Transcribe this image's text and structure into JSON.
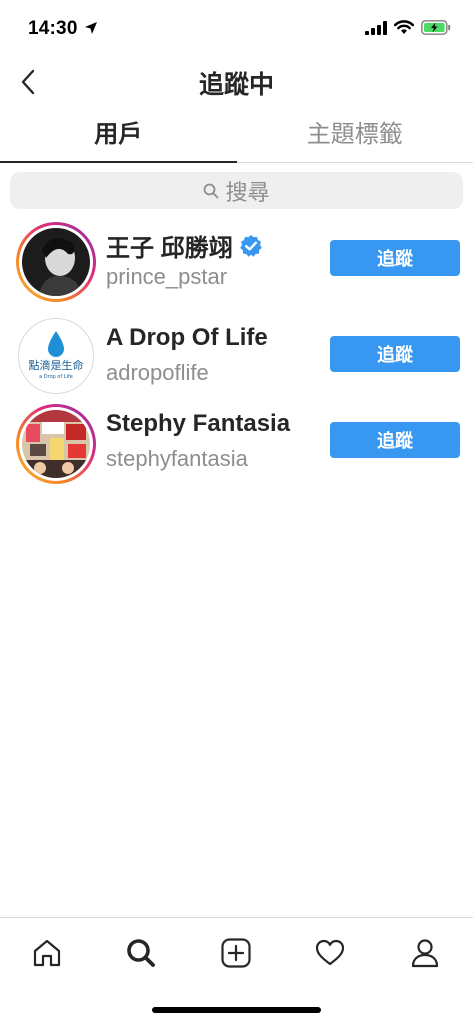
{
  "status_bar": {
    "time": "14:30"
  },
  "header": {
    "title": "追蹤中"
  },
  "tabs": [
    {
      "label": "用戶"
    },
    {
      "label": "主題標籤"
    }
  ],
  "search": {
    "placeholder": "搜尋"
  },
  "users": [
    {
      "display_name": "王子 邱勝翊",
      "handle": "prince_pstar",
      "verified": true,
      "button": "追蹤"
    },
    {
      "display_name": "A Drop Of Life",
      "handle": "adropoflife",
      "verified": false,
      "button": "追蹤",
      "logo_text": "點滴是生命",
      "logo_sub": "a Drop of Life"
    },
    {
      "display_name": "Stephy Fantasia",
      "handle": "stephyfantasia",
      "verified": false,
      "button": "追蹤"
    }
  ],
  "colors": {
    "accent": "#3897f0",
    "text": "#262626",
    "secondary": "#8e8e8e"
  },
  "bottom_nav": [
    "home-icon",
    "search-icon",
    "add-post-icon",
    "activity-heart-icon",
    "profile-icon"
  ]
}
